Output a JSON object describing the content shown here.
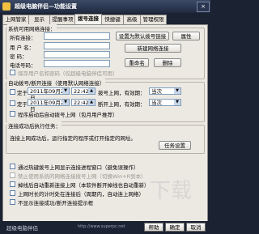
{
  "window": {
    "title": "超级电脑伴侣—功能设置",
    "close": "×"
  },
  "tabs": [
    {
      "label": "上网管家"
    },
    {
      "label": "显示"
    },
    {
      "label": "提醒事项"
    },
    {
      "label": "拨号连接"
    },
    {
      "label": "快捷键"
    },
    {
      "label": "高级"
    },
    {
      "label": "管理权限"
    }
  ],
  "active_tab": "拨号连接",
  "network_group": {
    "title": "系统可用网络连接：",
    "conn_label": "所有连接：",
    "set_default_btn": "设置为默认拨号链接",
    "properties_btn": "属性",
    "username_label": "用 户 名：",
    "password_label": "密   码：",
    "phone_label": "电话号码：",
    "new_btn": "新建网络连接",
    "rename_btn": "重命名",
    "delete_btn": "删除",
    "save_pwd_label": "保存用户名和密码（仅超级电脑伴侣可用）"
  },
  "auto_group": {
    "title": "自动拨号/断开连接（使用默认网络连接）",
    "row1_label": "定于",
    "row1_date": "2011年09月21日",
    "row1_time": "22:42",
    "row1_action": "拨号上网，有效期：",
    "row1_period": "当次",
    "row2_label": "定于",
    "row2_date": "2011年09月21日",
    "row2_time": "22:42",
    "row2_action": "断开上网，有效期：",
    "row2_period": "当次",
    "program_exit_label": "程序启动后自动拨号上网（包月用户推荐）"
  },
  "task_group": {
    "title": "连接成功后执行任务：",
    "desc": "连接上网成功后，运行指定的程序或打开指定的网址。",
    "task_btn": "任务设置"
  },
  "options": [
    {
      "label": "通过热键拨号上网显示连接进程窗口（避免误操作）",
      "disabled": false
    },
    {
      "label": "禁止使用系统的网络连接拨号上网（切换Win+R到本）",
      "disabled": true
    },
    {
      "label": "掉线后自动重新连接上网（本软件断开掉线也自动重新）",
      "disabled": false
    },
    {
      "label": "上网时长的计时处在连接后（周期内，自动连上网络）",
      "disabled": false
    },
    {
      "label": "不显示连接成功/断开连接提示框",
      "disabled": false
    }
  ],
  "status": {
    "brand": "超级电脑伴侣",
    "url": "http://www.superpc.net",
    "help_btn": "帮助",
    "ok_btn": "确定",
    "cancel_btn": "取消"
  },
  "watermark": "下载"
}
